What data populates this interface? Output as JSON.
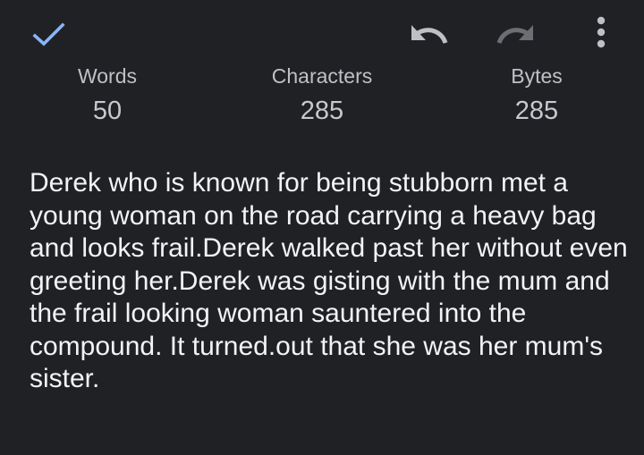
{
  "toolbar": {
    "check_icon": "check-icon",
    "undo_icon": "undo-icon",
    "redo_icon": "redo-icon",
    "more_icon": "more-vert-icon",
    "accent_color": "#8ab4f8",
    "undo_color": "#bdc1c6",
    "redo_disabled_color": "#6b6e72"
  },
  "stats": {
    "words_label": "Words",
    "words_value": "50",
    "characters_label": "Characters",
    "characters_value": "285",
    "bytes_label": "Bytes",
    "bytes_value": "285"
  },
  "content": {
    "text": "Derek who is known for being stubborn met a young woman on the road carrying a heavy bag and looks frail.Derek walked past her without even greeting her.Derek was gisting with the mum and the frail looking woman sauntered into the compound. It turned.out that she was her mum's sister."
  },
  "colors": {
    "background": "#202124",
    "text": "#f1f3f4"
  }
}
